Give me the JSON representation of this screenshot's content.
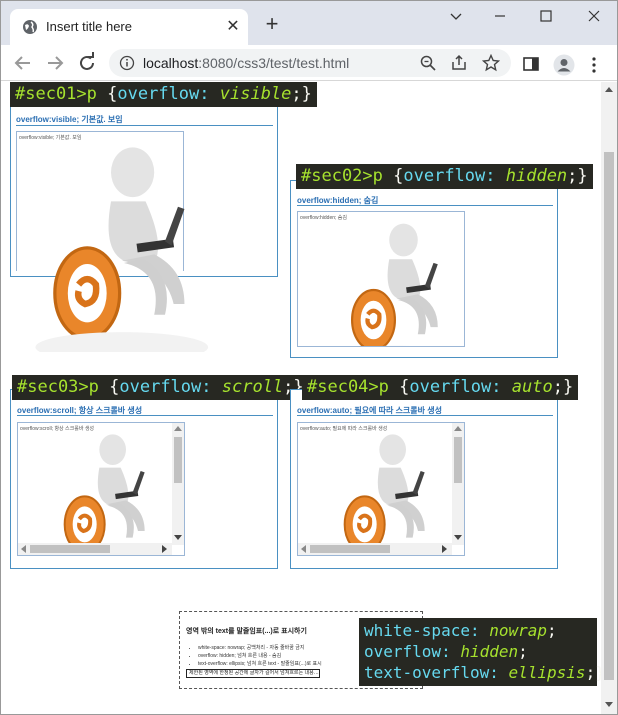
{
  "browser": {
    "tab_title": "Insert title here",
    "url_host": "localhost",
    "url_rest": ":8080/css3/test/test.html",
    "icons": [
      "globe-icon",
      "close-icon",
      "plus-icon",
      "chevron-down-icon",
      "minimize-icon",
      "maximize-icon",
      "close-window-icon",
      "back-arrow-icon",
      "forward-arrow-icon",
      "reload-icon",
      "info-icon",
      "zoom-icon",
      "share-icon",
      "star-icon",
      "side-panel-icon",
      "profile-icon",
      "menu-dots-icon"
    ]
  },
  "sec01": {
    "code_selector": "#sec01>p",
    "code_open": " {",
    "code_prop": "overflow:",
    "code_value": "visible",
    "code_close": ";}",
    "title": "overflow:visible; 기본값. 보임",
    "p_text": "overflow:visible; 기본값. 보임"
  },
  "sec02": {
    "code_selector": "#sec02>p",
    "code_open": " {",
    "code_prop": "overflow:",
    "code_value": "hidden",
    "code_close": ";}",
    "title": "overflow:hidden; 숨김",
    "p_text": "overflow:hidden; 숨김"
  },
  "sec03": {
    "code_selector": "#sec03>p",
    "code_open": " {",
    "code_prop": "overflow:",
    "code_value": "scroll",
    "code_close": ";}",
    "title": "overflow:scroll; 항상 스크롤바 생성",
    "p_text": "overflow:scroll; 항상 스크롤바 생성"
  },
  "sec04": {
    "code_selector": "#sec04>p",
    "code_open": " {",
    "code_prop": "overflow:",
    "code_value": "auto",
    "code_close": ";}",
    "title": "overflow:auto; 필요에 따라 스크롤바 생성",
    "p_text": "overflow:auto; 필요에 따라 스크롤바 생성"
  },
  "sec05": {
    "title": "영역 밖의 text를 말줄임표(...)로 표시하기",
    "items": [
      "white-space: nowrap; 공백처리 - 자동 줄바꿈 금지",
      "overflow: hidden; 넘쳐 흐른 내용 - 숨김",
      "text-overflow: ellipsis; 넘쳐 흐른 text - 말줄임표(...)로 표시"
    ],
    "box_text": "제한된 영역에 한정된 공간에 글자가 길어서 넘쳐흐르는 내용입니다",
    "code_line1_prop": "white-space:",
    "code_line1_val": "nowrap",
    "code_line2_prop": "overflow:",
    "code_line2_val": "hidden",
    "code_line3_prop": "text-overflow:",
    "code_line3_val": "ellipsis",
    "code_semicolon": ";",
    "code_close": ";}"
  }
}
